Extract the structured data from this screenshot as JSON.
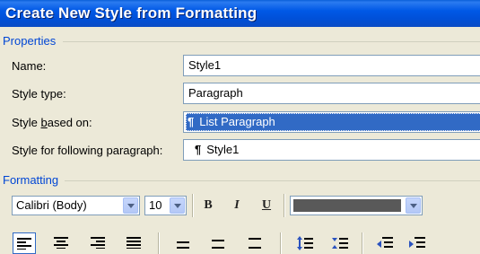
{
  "window": {
    "title": "Create New Style from Formatting"
  },
  "properties": {
    "section_label": "Properties",
    "name_label": "Name:",
    "name_value": "Style1",
    "type_label": "Style type:",
    "type_value": "Paragraph",
    "based_label": "Style based on:",
    "based_value": "List Paragraph",
    "following_label": "Style for following paragraph:",
    "following_value": "Style1"
  },
  "formatting": {
    "section_label": "Formatting",
    "font": "Calibri (Body)",
    "size": "10",
    "bold": "B",
    "italic": "I",
    "underline": "U",
    "color": "#595959"
  },
  "icons": {
    "pilcrow": "¶"
  }
}
